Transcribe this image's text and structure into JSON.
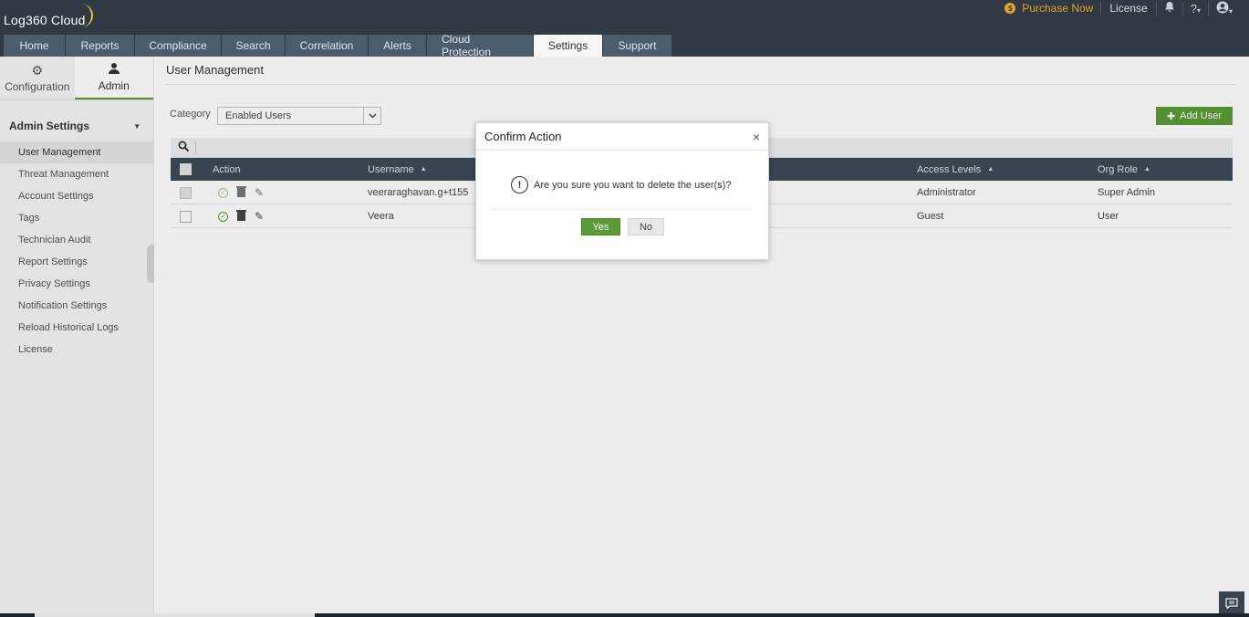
{
  "header": {
    "brand": "Log360 Cloud",
    "purchase_label": "Purchase Now",
    "license_label": "License",
    "tabs": [
      "Home",
      "Reports",
      "Compliance",
      "Search",
      "Correlation",
      "Alerts",
      "Cloud Protection",
      "Settings",
      "Support"
    ],
    "active_tab": "Settings"
  },
  "sidebar": {
    "tabs": [
      {
        "label": "Configuration",
        "icon": "gear-icon"
      },
      {
        "label": "Admin",
        "icon": "user-icon"
      }
    ],
    "heading": "Admin Settings",
    "items": [
      {
        "label": "User Management"
      },
      {
        "label": "Threat Management"
      },
      {
        "label": "Account Settings"
      },
      {
        "label": "Tags"
      },
      {
        "label": "Technician Audit"
      },
      {
        "label": "Report Settings"
      },
      {
        "label": "Privacy Settings"
      },
      {
        "label": "Notification Settings"
      },
      {
        "label": "Reload Historical Logs"
      },
      {
        "label": "License"
      }
    ]
  },
  "main": {
    "title": "User Management",
    "category_label": "Category",
    "category_value": "Enabled Users",
    "add_user_label": "Add User",
    "columns": [
      "Action",
      "Username",
      "Access Levels",
      "Org Role"
    ],
    "rows": [
      {
        "username": "veeraraghavan.g+t155",
        "access": "Administrator",
        "org_role": "Super Admin"
      },
      {
        "username": "Veera",
        "access": "Guest",
        "org_role": "User"
      }
    ]
  },
  "modal": {
    "title": "Confirm Action",
    "close": "×",
    "message": "Are you sure you want to delete the user(s)?",
    "yes": "Yes",
    "no": "No"
  },
  "colors": {
    "header_bg": "#2f3a45",
    "tab_bg": "#4c5c6a",
    "accent_green": "#5b9a36",
    "purchase_orange": "#e0a32a",
    "table_header_bg": "#3d4a57"
  }
}
